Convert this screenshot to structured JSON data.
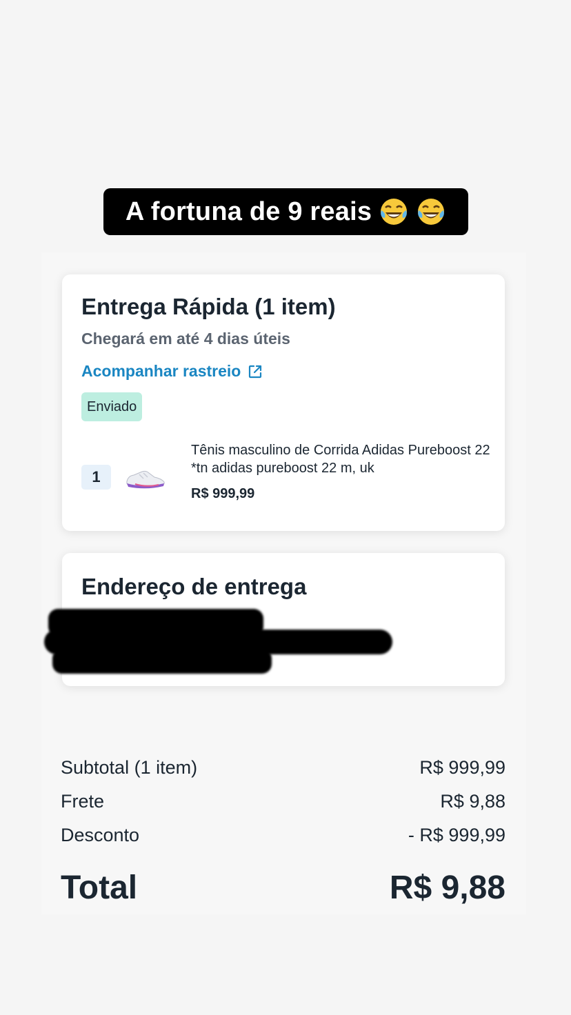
{
  "caption": {
    "text": "A fortuna de 9 reais",
    "emojis": [
      "face-with-tears-of-joy-icon",
      "face-with-tears-of-joy-icon"
    ]
  },
  "delivery": {
    "title": "Entrega Rápida (1 item)",
    "eta": "Chegará em até 4 dias úteis",
    "tracking_label": "Acompanhar rastreio",
    "tracking_icon": "external-link-icon",
    "status": "Enviado",
    "status_color": "#bdeee0",
    "link_color": "#1a86c2",
    "item": {
      "quantity": "1",
      "name": "Tênis masculino de Corrida Adidas Pureboost 22 *tn adidas pureboost 22 m, uk",
      "price": "R$ 999,99",
      "thumbnail_icon": "sneaker-thumbnail"
    }
  },
  "address": {
    "title": "Endereço de entrega"
  },
  "summary": {
    "subtotal_label": "Subtotal (1 item)",
    "subtotal_value": "R$ 999,99",
    "shipping_label": "Frete",
    "shipping_value": "R$ 9,88",
    "discount_label": "Desconto",
    "discount_value": "- R$ 999,99",
    "total_label": "Total",
    "total_value": "R$ 9,88"
  }
}
